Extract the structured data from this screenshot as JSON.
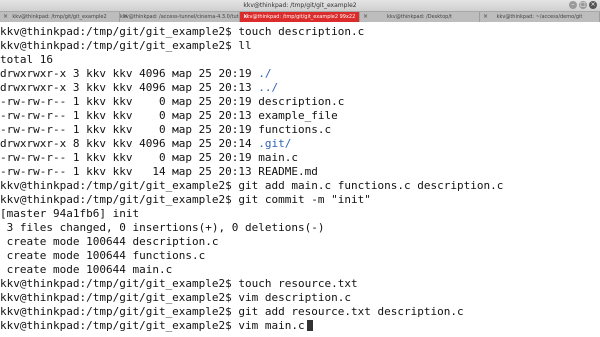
{
  "window": {
    "title": "kkv@thinkpad: /tmp/git/git_example2",
    "tabs": [
      {
        "label": "kkv@thinkpad: /tmp/git/git_example2",
        "active": false
      },
      {
        "label": "kkv@thinkpad: /access-tunnel/cinema-4.3.0/tutorial",
        "active": false
      },
      {
        "label": "kkv@thinkpad: /tmp/git/git_example2 99x22",
        "active": true
      },
      {
        "label": "kkv@thinkpad: /Desktop/t",
        "active": false
      },
      {
        "label": "kkv@thinkpad: ~/access/demo/git",
        "active": false
      }
    ]
  },
  "terminal": {
    "lines": [
      {
        "text": "kkv@thinkpad:/tmp/git/git_example2$ touch description.c"
      },
      {
        "text": "kkv@thinkpad:/tmp/git/git_example2$ ll"
      },
      {
        "text": "total 16"
      },
      {
        "text": "drwxrwxr-x 3 kkv kkv 4096 мар 25 20:19 ",
        "dir": "./"
      },
      {
        "text": "drwxrwxr-x 3 kkv kkv 4096 мар 25 20:13 ",
        "dir": "../"
      },
      {
        "text": "-rw-rw-r-- 1 kkv kkv    0 мар 25 20:19 description.c"
      },
      {
        "text": "-rw-rw-r-- 1 kkv kkv    0 мар 25 20:13 example_file"
      },
      {
        "text": "-rw-rw-r-- 1 kkv kkv    0 мар 25 20:19 functions.c"
      },
      {
        "text": "drwxrwxr-x 8 kkv kkv 4096 мар 25 20:14 ",
        "dir": ".git/"
      },
      {
        "text": "-rw-rw-r-- 1 kkv kkv    0 мар 25 20:19 main.c"
      },
      {
        "text": "-rw-rw-r-- 1 kkv kkv   14 мар 25 20:13 README.md"
      },
      {
        "text": "kkv@thinkpad:/tmp/git/git_example2$ git add main.c functions.c description.c"
      },
      {
        "text": "kkv@thinkpad:/tmp/git/git_example2$ git commit -m \"init\""
      },
      {
        "text": "[master 94a1fb6] init"
      },
      {
        "text": " 3 files changed, 0 insertions(+), 0 deletions(-)"
      },
      {
        "text": " create mode 100644 description.c"
      },
      {
        "text": " create mode 100644 functions.c"
      },
      {
        "text": " create mode 100644 main.c"
      },
      {
        "text": "kkv@thinkpad:/tmp/git/git_example2$ touch resource.txt"
      },
      {
        "text": "kkv@thinkpad:/tmp/git/git_example2$ vim description.c"
      },
      {
        "text": "kkv@thinkpad:/tmp/git/git_example2$ git add resource.txt description.c"
      },
      {
        "text": "kkv@thinkpad:/tmp/git/git_example2$ vim main.c",
        "cursor": true
      }
    ]
  },
  "colors": {
    "background": "#ffffff",
    "foreground": "#111111",
    "directory": "#2f62b5",
    "active_tab": "#dc2b2b"
  }
}
